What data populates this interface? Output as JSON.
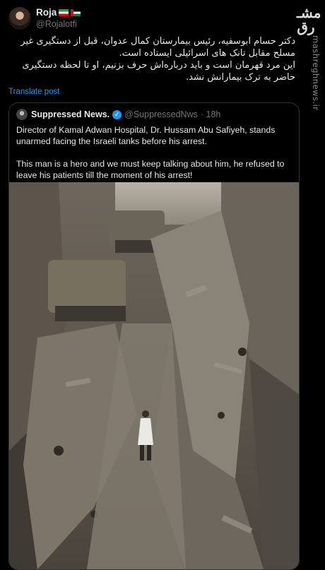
{
  "tweet": {
    "display_name": "Roja",
    "handle": "@Rojalotfi",
    "text": "دکتر حسام ابوسفیه، رئیس بیمارستان کمال عدوان، قبل از دستگیری غیر مسلح مقابل تانک های اسرائیلی ایستاده است.\nاین مرد قهرمان است و باید درباره‌اش حرف بزنیم، او تا لحظه دستگیری حاضر به ترک بیمارانش نشد.",
    "translate_label": "Translate post"
  },
  "quoted": {
    "display_name": "Suppressed News.",
    "handle": "@SuppressedNws",
    "time": "· 18h",
    "text": "Director of Kamal Adwan Hospital, Dr. Hussam Abu Safiyeh, stands unarmed facing the Israeli tanks before his arrest.\n\nThis man is a hero and we must keep talking about him, he refused to leave his patients till the moment of his arrest!"
  },
  "watermark": {
    "site": "mashreghnews.ir",
    "logo_text": "مشرق"
  },
  "icons": [
    "verified-badge-icon",
    "iran-flag-icon",
    "palestine-flag-icon"
  ],
  "colors": {
    "link": "#1d9bf0",
    "muted": "#71767b",
    "background": "#000000"
  }
}
